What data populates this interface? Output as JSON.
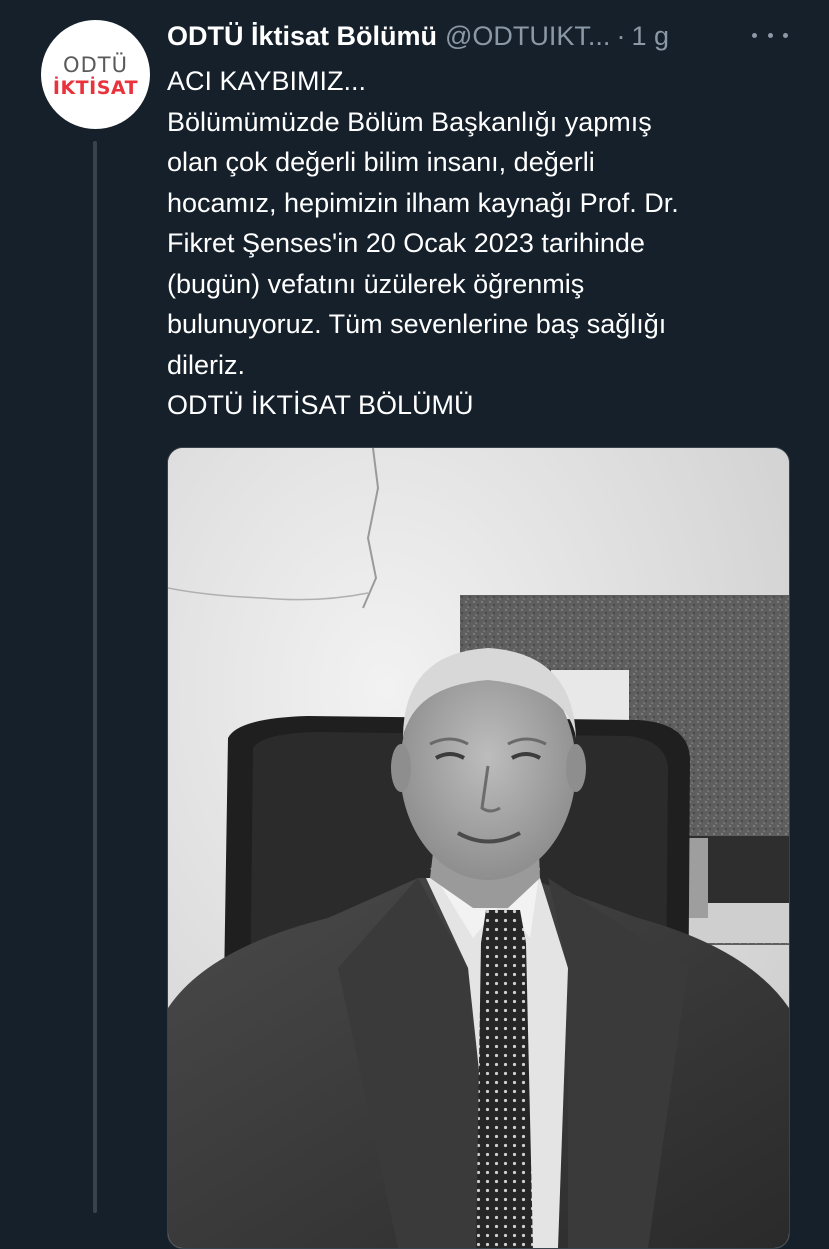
{
  "account": {
    "name": "ODTÜ İktisat Bölümü",
    "handle": "@ODTUIKT...",
    "separator": "·",
    "time": "1 g",
    "avatar": {
      "line1": "ODTÜ",
      "line2": "İKTİSAT",
      "accent_color": "#e8323c"
    }
  },
  "tweet": {
    "lines": [
      "ACI KAYBIMIZ...",
      "Bölümümüzde Bölüm Başkanlığı yapmış",
      "olan çok değerli bilim insanı, değerli",
      "hocamız, hepimizin ilham kaynağı Prof. Dr.",
      "Fikret Şenses'in 20 Ocak 2023 tarihinde",
      "(bugün) vefatını üzülerek öğrenmiş",
      "bulunuyoruz. Tüm sevenlerine baş sağlığı",
      "dileriz.",
      "ODTÜ İKTİSAT BÖLÜMÜ"
    ]
  },
  "media": {
    "type": "black-and-white portrait photo"
  },
  "theme": {
    "background": "#15202b",
    "muted": "#8b98a5",
    "border": "#38444d"
  }
}
